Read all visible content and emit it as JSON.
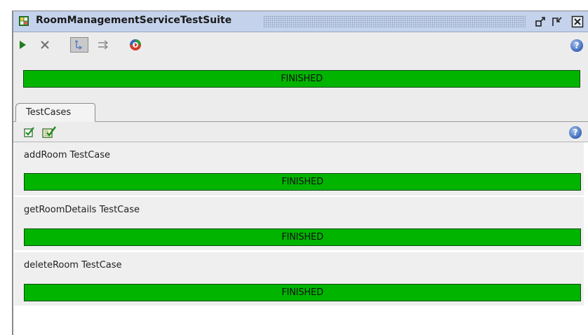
{
  "window": {
    "title": "RoomManagementServiceTestSuite"
  },
  "colors": {
    "titlebar": "#c4d2ec",
    "progress_green": "#00b400",
    "panel": "#ececec"
  },
  "icons": {
    "app": "grid-icon",
    "run": "play-icon",
    "cancel": "cancel-icon",
    "mode_sequential": "sequential-icon",
    "mode_parallel": "parallel-icon",
    "options": "options-icon",
    "help": "help-icon"
  },
  "suite": {
    "status": "FINISHED",
    "progress": 1.0
  },
  "tabs": [
    {
      "label": "TestCases"
    }
  ],
  "testcases": [
    {
      "name": "addRoom TestCase",
      "status": "FINISHED",
      "progress": 1.0
    },
    {
      "name": "getRoomDetails TestCase",
      "status": "FINISHED",
      "progress": 1.0
    },
    {
      "name": "deleteRoom TestCase",
      "status": "FINISHED",
      "progress": 1.0
    }
  ],
  "help_glyph": "?"
}
